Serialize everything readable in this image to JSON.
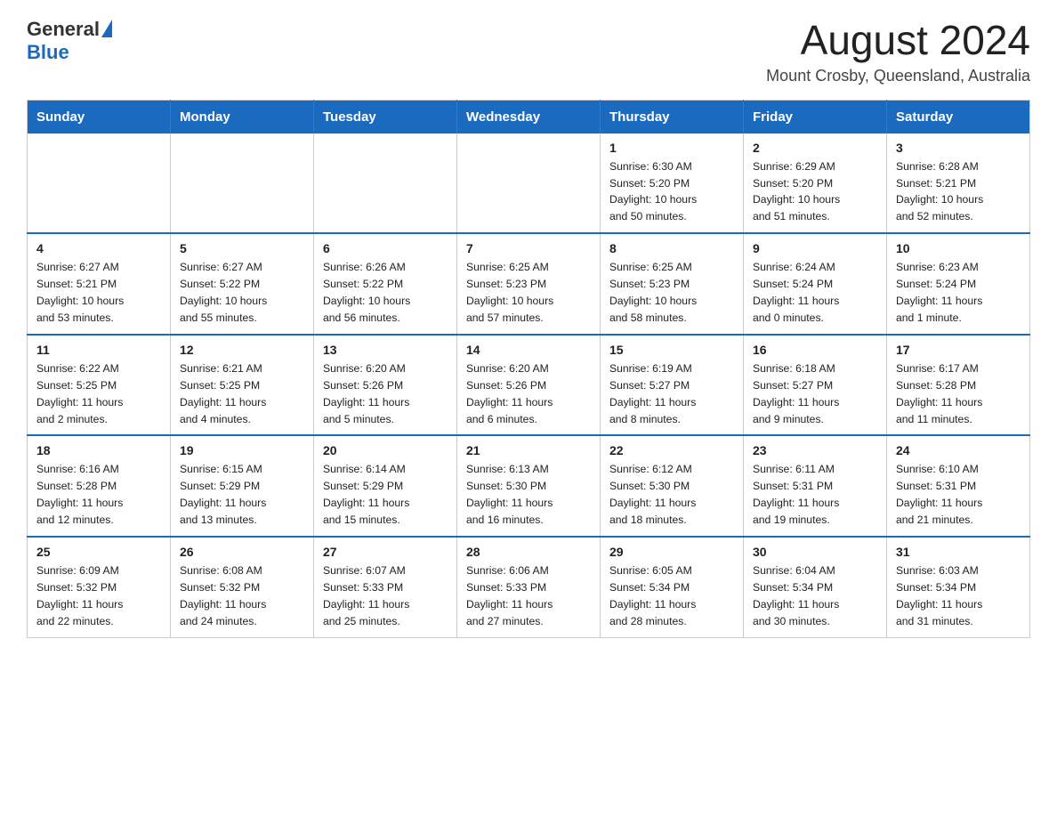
{
  "header": {
    "logo_general": "General",
    "logo_blue": "Blue",
    "title": "August 2024",
    "subtitle": "Mount Crosby, Queensland, Australia"
  },
  "calendar": {
    "days_of_week": [
      "Sunday",
      "Monday",
      "Tuesday",
      "Wednesday",
      "Thursday",
      "Friday",
      "Saturday"
    ],
    "weeks": [
      [
        {
          "day": "",
          "info": ""
        },
        {
          "day": "",
          "info": ""
        },
        {
          "day": "",
          "info": ""
        },
        {
          "day": "",
          "info": ""
        },
        {
          "day": "1",
          "info": "Sunrise: 6:30 AM\nSunset: 5:20 PM\nDaylight: 10 hours\nand 50 minutes."
        },
        {
          "day": "2",
          "info": "Sunrise: 6:29 AM\nSunset: 5:20 PM\nDaylight: 10 hours\nand 51 minutes."
        },
        {
          "day": "3",
          "info": "Sunrise: 6:28 AM\nSunset: 5:21 PM\nDaylight: 10 hours\nand 52 minutes."
        }
      ],
      [
        {
          "day": "4",
          "info": "Sunrise: 6:27 AM\nSunset: 5:21 PM\nDaylight: 10 hours\nand 53 minutes."
        },
        {
          "day": "5",
          "info": "Sunrise: 6:27 AM\nSunset: 5:22 PM\nDaylight: 10 hours\nand 55 minutes."
        },
        {
          "day": "6",
          "info": "Sunrise: 6:26 AM\nSunset: 5:22 PM\nDaylight: 10 hours\nand 56 minutes."
        },
        {
          "day": "7",
          "info": "Sunrise: 6:25 AM\nSunset: 5:23 PM\nDaylight: 10 hours\nand 57 minutes."
        },
        {
          "day": "8",
          "info": "Sunrise: 6:25 AM\nSunset: 5:23 PM\nDaylight: 10 hours\nand 58 minutes."
        },
        {
          "day": "9",
          "info": "Sunrise: 6:24 AM\nSunset: 5:24 PM\nDaylight: 11 hours\nand 0 minutes."
        },
        {
          "day": "10",
          "info": "Sunrise: 6:23 AM\nSunset: 5:24 PM\nDaylight: 11 hours\nand 1 minute."
        }
      ],
      [
        {
          "day": "11",
          "info": "Sunrise: 6:22 AM\nSunset: 5:25 PM\nDaylight: 11 hours\nand 2 minutes."
        },
        {
          "day": "12",
          "info": "Sunrise: 6:21 AM\nSunset: 5:25 PM\nDaylight: 11 hours\nand 4 minutes."
        },
        {
          "day": "13",
          "info": "Sunrise: 6:20 AM\nSunset: 5:26 PM\nDaylight: 11 hours\nand 5 minutes."
        },
        {
          "day": "14",
          "info": "Sunrise: 6:20 AM\nSunset: 5:26 PM\nDaylight: 11 hours\nand 6 minutes."
        },
        {
          "day": "15",
          "info": "Sunrise: 6:19 AM\nSunset: 5:27 PM\nDaylight: 11 hours\nand 8 minutes."
        },
        {
          "day": "16",
          "info": "Sunrise: 6:18 AM\nSunset: 5:27 PM\nDaylight: 11 hours\nand 9 minutes."
        },
        {
          "day": "17",
          "info": "Sunrise: 6:17 AM\nSunset: 5:28 PM\nDaylight: 11 hours\nand 11 minutes."
        }
      ],
      [
        {
          "day": "18",
          "info": "Sunrise: 6:16 AM\nSunset: 5:28 PM\nDaylight: 11 hours\nand 12 minutes."
        },
        {
          "day": "19",
          "info": "Sunrise: 6:15 AM\nSunset: 5:29 PM\nDaylight: 11 hours\nand 13 minutes."
        },
        {
          "day": "20",
          "info": "Sunrise: 6:14 AM\nSunset: 5:29 PM\nDaylight: 11 hours\nand 15 minutes."
        },
        {
          "day": "21",
          "info": "Sunrise: 6:13 AM\nSunset: 5:30 PM\nDaylight: 11 hours\nand 16 minutes."
        },
        {
          "day": "22",
          "info": "Sunrise: 6:12 AM\nSunset: 5:30 PM\nDaylight: 11 hours\nand 18 minutes."
        },
        {
          "day": "23",
          "info": "Sunrise: 6:11 AM\nSunset: 5:31 PM\nDaylight: 11 hours\nand 19 minutes."
        },
        {
          "day": "24",
          "info": "Sunrise: 6:10 AM\nSunset: 5:31 PM\nDaylight: 11 hours\nand 21 minutes."
        }
      ],
      [
        {
          "day": "25",
          "info": "Sunrise: 6:09 AM\nSunset: 5:32 PM\nDaylight: 11 hours\nand 22 minutes."
        },
        {
          "day": "26",
          "info": "Sunrise: 6:08 AM\nSunset: 5:32 PM\nDaylight: 11 hours\nand 24 minutes."
        },
        {
          "day": "27",
          "info": "Sunrise: 6:07 AM\nSunset: 5:33 PM\nDaylight: 11 hours\nand 25 minutes."
        },
        {
          "day": "28",
          "info": "Sunrise: 6:06 AM\nSunset: 5:33 PM\nDaylight: 11 hours\nand 27 minutes."
        },
        {
          "day": "29",
          "info": "Sunrise: 6:05 AM\nSunset: 5:34 PM\nDaylight: 11 hours\nand 28 minutes."
        },
        {
          "day": "30",
          "info": "Sunrise: 6:04 AM\nSunset: 5:34 PM\nDaylight: 11 hours\nand 30 minutes."
        },
        {
          "day": "31",
          "info": "Sunrise: 6:03 AM\nSunset: 5:34 PM\nDaylight: 11 hours\nand 31 minutes."
        }
      ]
    ]
  }
}
